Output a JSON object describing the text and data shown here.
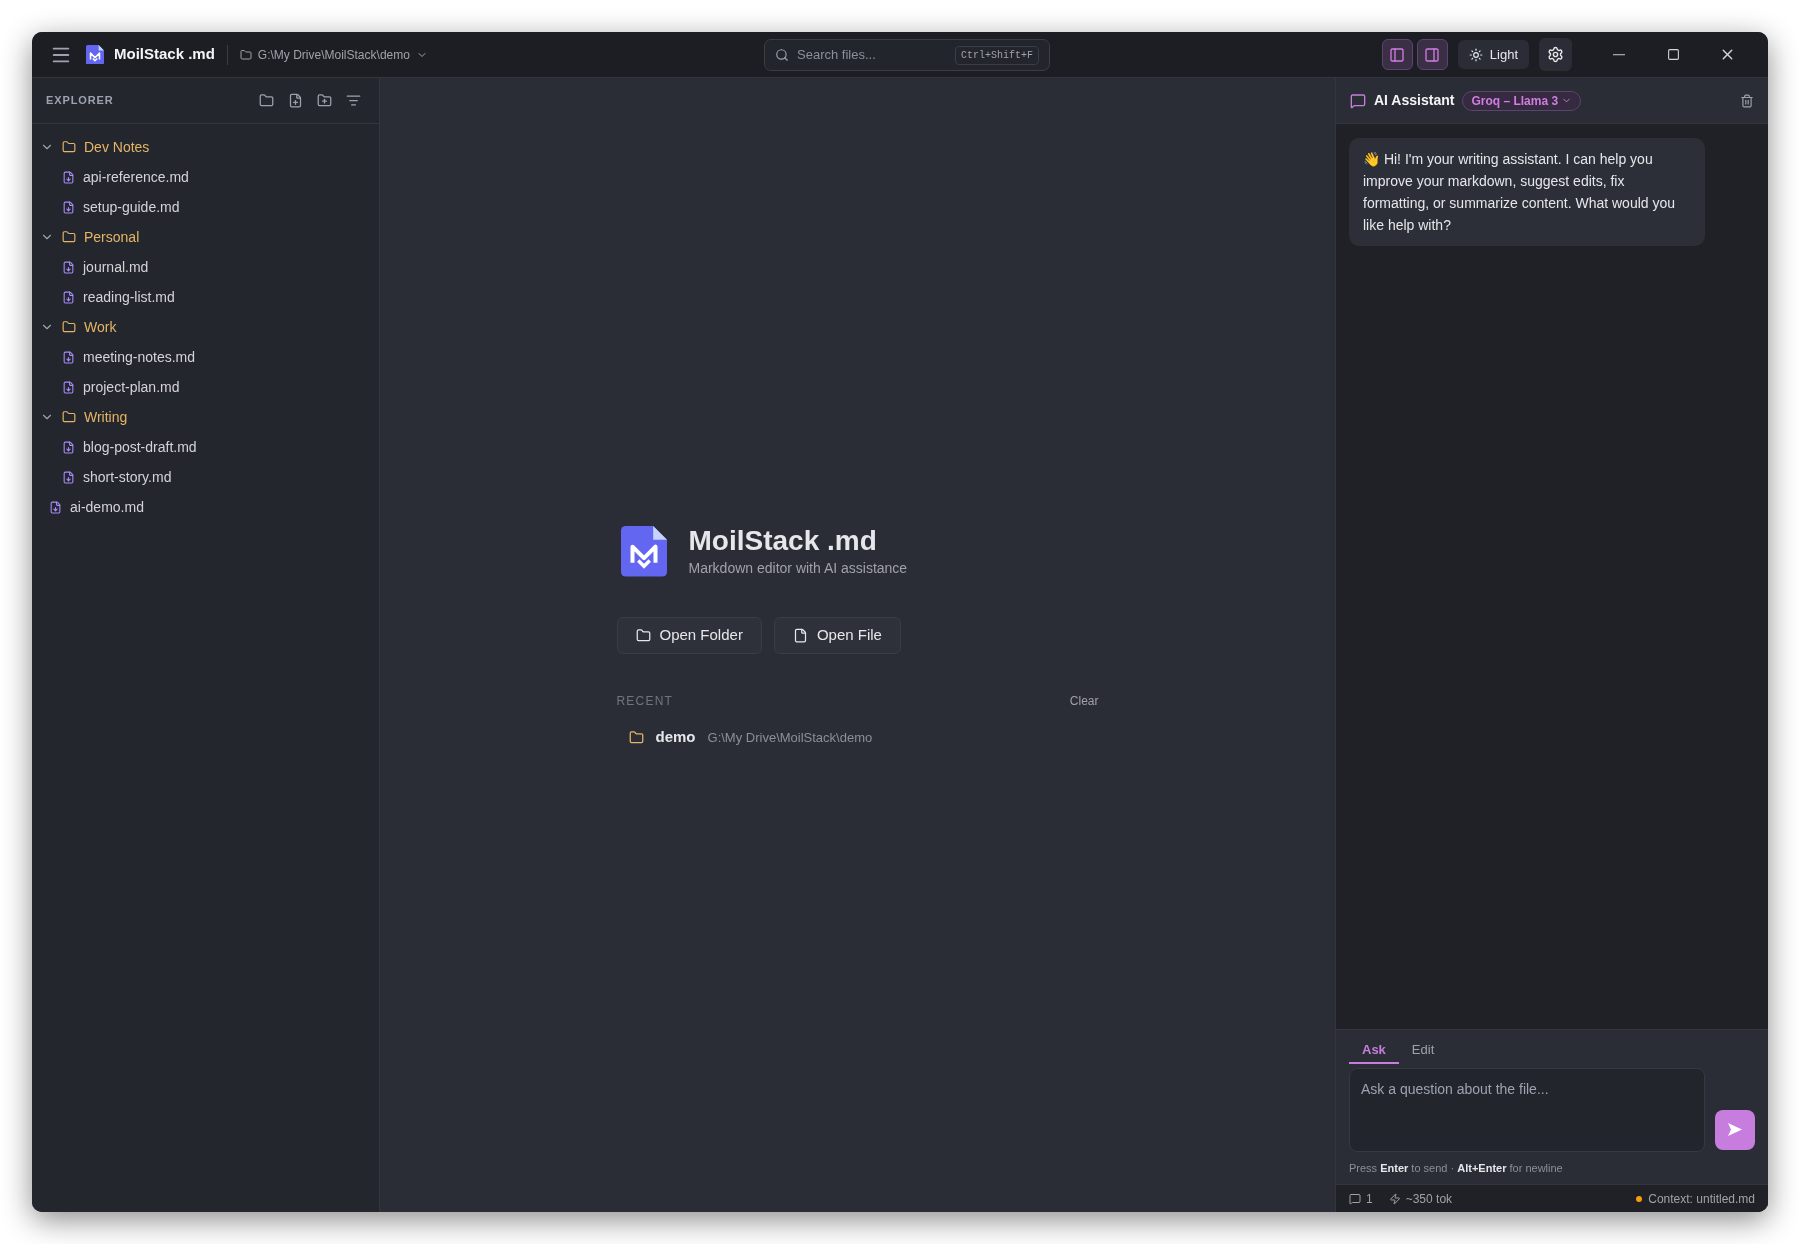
{
  "titlebar": {
    "app_name": "MoilStack .md",
    "path": "G:\\My Drive\\MoilStack\\demo",
    "search": {
      "placeholder": "Search files...",
      "shortcut": "Ctrl+Shift+F"
    },
    "layout_toggles": [
      {
        "kind": "left",
        "on": true
      },
      {
        "kind": "right",
        "on": true
      }
    ],
    "theme_button": "Light"
  },
  "explorer": {
    "title": "EXPLORER",
    "tree": [
      {
        "kind": "folder",
        "label": "Dev Notes",
        "expanded": true,
        "children": [
          {
            "kind": "file",
            "label": "api-reference.md"
          },
          {
            "kind": "file",
            "label": "setup-guide.md"
          }
        ]
      },
      {
        "kind": "folder",
        "label": "Personal",
        "expanded": true,
        "children": [
          {
            "kind": "file",
            "label": "journal.md"
          },
          {
            "kind": "file",
            "label": "reading-list.md"
          }
        ]
      },
      {
        "kind": "folder",
        "label": "Work",
        "expanded": true,
        "children": [
          {
            "kind": "file",
            "label": "meeting-notes.md"
          },
          {
            "kind": "file",
            "label": "project-plan.md"
          }
        ]
      },
      {
        "kind": "folder",
        "label": "Writing",
        "expanded": true,
        "children": [
          {
            "kind": "file",
            "label": "blog-post-draft.md"
          },
          {
            "kind": "file",
            "label": "short-story.md"
          }
        ]
      },
      {
        "kind": "file",
        "label": "ai-demo.md"
      }
    ]
  },
  "welcome": {
    "title": "MoilStack .md",
    "subtitle": "Markdown editor with AI assistance",
    "buttons": [
      {
        "kind": "folder",
        "label": "Open Folder"
      },
      {
        "kind": "file",
        "label": "Open File"
      }
    ],
    "recent_label": "RECENT",
    "clear": "Clear",
    "recent": [
      {
        "name": "demo",
        "path": "G:\\My Drive\\MoilStack\\demo"
      }
    ]
  },
  "assistant": {
    "title": "AI Assistant",
    "model": "Groq – Llama 3",
    "message": "👋 Hi! I'm your writing assistant. I can help you improve your markdown, suggest edits, fix formatting, or summarize content. What would you like help with?",
    "tabs": [
      {
        "label": "Ask",
        "selected": true
      },
      {
        "label": "Edit",
        "selected": false
      }
    ],
    "input": {
      "placeholder": "Ask a question about the file..."
    },
    "hint": "Press **Enter** to send · **Alt+Enter** for newline",
    "status": {
      "messages": "1",
      "tokens": "~350 tok",
      "context": "Context: untitled.md"
    }
  }
}
